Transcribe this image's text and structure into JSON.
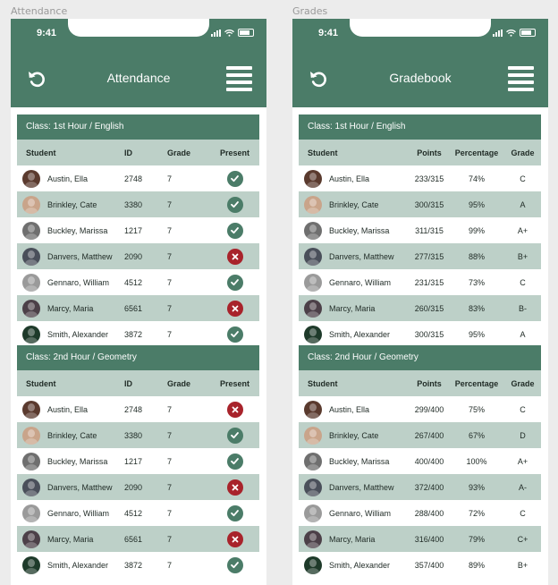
{
  "frames": [
    {
      "label": "Attendance",
      "type": "attendance",
      "time": "9:41",
      "title": "Attendance",
      "icons": {
        "left": "undo-icon",
        "right": "menu-icon"
      },
      "columns": [
        "Student",
        "ID",
        "Grade",
        "Present"
      ],
      "classes": [
        {
          "title": "Class: 1st Hour / English",
          "rows": [
            {
              "name": "Austin, Ella",
              "id": "2748",
              "grade": "7",
              "present": true
            },
            {
              "name": "Brinkley, Cate",
              "id": "3380",
              "grade": "7",
              "present": true
            },
            {
              "name": "Buckley, Marissa",
              "id": "1217",
              "grade": "7",
              "present": true
            },
            {
              "name": "Danvers, Matthew",
              "id": "2090",
              "grade": "7",
              "present": false
            },
            {
              "name": "Gennaro, William",
              "id": "4512",
              "grade": "7",
              "present": true
            },
            {
              "name": "Marcy, Maria",
              "id": "6561",
              "grade": "7",
              "present": false
            },
            {
              "name": "Smith, Alexander",
              "id": "3872",
              "grade": "7",
              "present": true
            }
          ]
        },
        {
          "title": "Class: 2nd Hour / Geometry",
          "rows": [
            {
              "name": "Austin, Ella",
              "id": "2748",
              "grade": "7",
              "present": false
            },
            {
              "name": "Brinkley, Cate",
              "id": "3380",
              "grade": "7",
              "present": true
            },
            {
              "name": "Buckley, Marissa",
              "id": "1217",
              "grade": "7",
              "present": true
            },
            {
              "name": "Danvers, Matthew",
              "id": "2090",
              "grade": "7",
              "present": false
            },
            {
              "name": "Gennaro, William",
              "id": "4512",
              "grade": "7",
              "present": true
            },
            {
              "name": "Marcy, Maria",
              "id": "6561",
              "grade": "7",
              "present": false
            },
            {
              "name": "Smith, Alexander",
              "id": "3872",
              "grade": "7",
              "present": true
            }
          ]
        }
      ]
    },
    {
      "label": "Grades",
      "type": "grades",
      "time": "9:41",
      "title": "Gradebook",
      "icons": {
        "left": "undo-icon",
        "right": "menu-icon"
      },
      "columns": [
        "Student",
        "Points",
        "Percentage",
        "Grade"
      ],
      "classes": [
        {
          "title": "Class: 1st Hour / English",
          "rows": [
            {
              "name": "Austin, Ella",
              "points": "233/315",
              "pct": "74%",
              "grade": "C"
            },
            {
              "name": "Brinkley, Cate",
              "points": "300/315",
              "pct": "95%",
              "grade": "A"
            },
            {
              "name": "Buckley, Marissa",
              "points": "311/315",
              "pct": "99%",
              "grade": "A+"
            },
            {
              "name": "Danvers, Matthew",
              "points": "277/315",
              "pct": "88%",
              "grade": "B+"
            },
            {
              "name": "Gennaro, William",
              "points": "231/315",
              "pct": "73%",
              "grade": "C"
            },
            {
              "name": "Marcy, Maria",
              "points": "260/315",
              "pct": "83%",
              "grade": "B-"
            },
            {
              "name": "Smith, Alexander",
              "points": "300/315",
              "pct": "95%",
              "grade": "A"
            }
          ]
        },
        {
          "title": "Class: 2nd Hour / Geometry",
          "rows": [
            {
              "name": "Austin, Ella",
              "points": "299/400",
              "pct": "75%",
              "grade": "C"
            },
            {
              "name": "Brinkley, Cate",
              "points": "267/400",
              "pct": "67%",
              "grade": "D"
            },
            {
              "name": "Buckley, Marissa",
              "points": "400/400",
              "pct": "100%",
              "grade": "A+"
            },
            {
              "name": "Danvers, Matthew",
              "points": "372/400",
              "pct": "93%",
              "grade": "A-"
            },
            {
              "name": "Gennaro, William",
              "points": "288/400",
              "pct": "72%",
              "grade": "C"
            },
            {
              "name": "Marcy, Maria",
              "points": "316/400",
              "pct": "79%",
              "grade": "C+"
            },
            {
              "name": "Smith, Alexander",
              "points": "357/400",
              "pct": "89%",
              "grade": "B+"
            }
          ]
        }
      ]
    }
  ],
  "avatar_colors": [
    "#5a3a2e",
    "#c9a48a",
    "#6f6f6f",
    "#4a4f5a",
    "#9a9a9a",
    "#4c4048",
    "#1e3a2a"
  ],
  "colors": {
    "header": "#4b7c68",
    "column_header": "#bdd0c8",
    "present": "#4b7c68",
    "absent": "#a8232b"
  }
}
